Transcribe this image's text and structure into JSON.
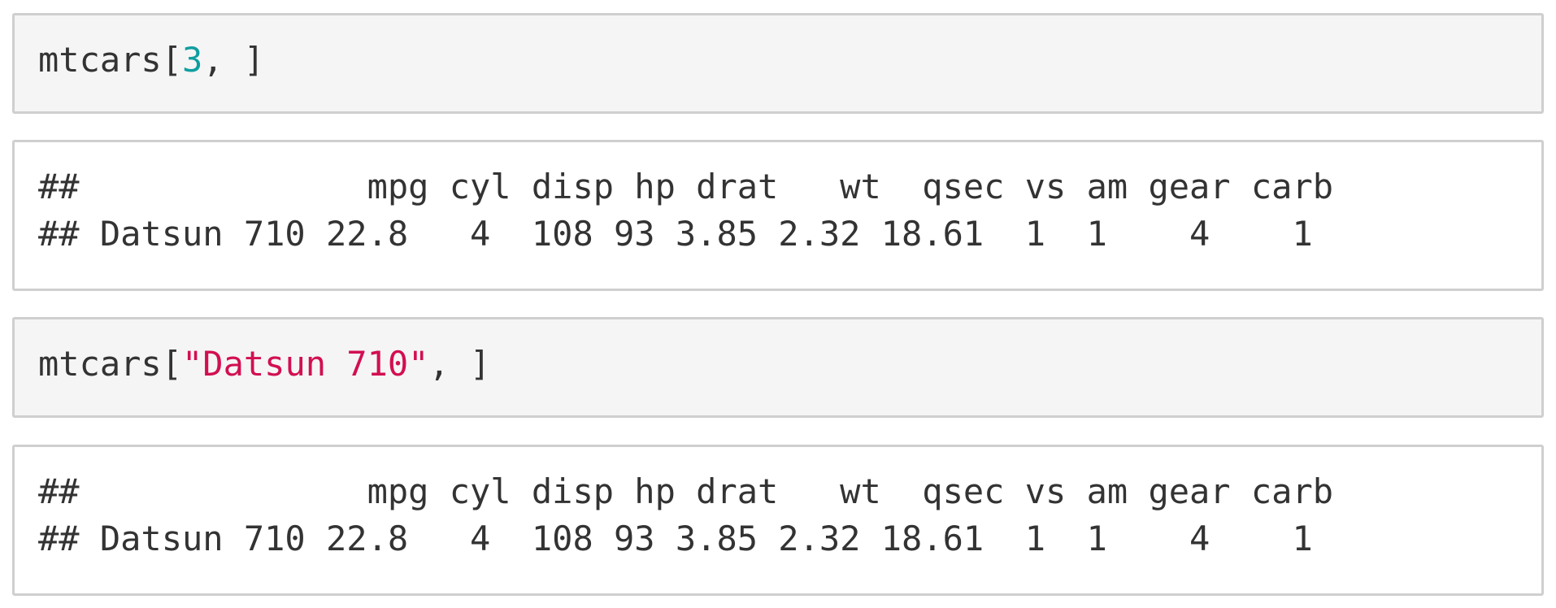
{
  "cells": [
    {
      "input": {
        "prefix": "mtcars[",
        "arg": "3",
        "suffix": ", ]"
      },
      "output": [
        "##              mpg cyl disp hp drat   wt  qsec vs am gear carb",
        "## Datsun 710 22.8   4  108 93 3.85 2.32 18.61  1  1    4    1"
      ]
    },
    {
      "input": {
        "prefix": "mtcars[",
        "arg": "\"Datsun 710\"",
        "suffix": ", ]"
      },
      "output": [
        "##              mpg cyl disp hp drat   wt  qsec vs am gear carb",
        "## Datsun 710 22.8   4  108 93 3.85 2.32 18.61  1  1    4    1"
      ]
    }
  ],
  "colors": {
    "number_token": "#0f9ea0",
    "string_token": "#d20f52",
    "code_text": "#333333",
    "input_background": "#f5f5f5",
    "border": "#cfcfcf"
  }
}
